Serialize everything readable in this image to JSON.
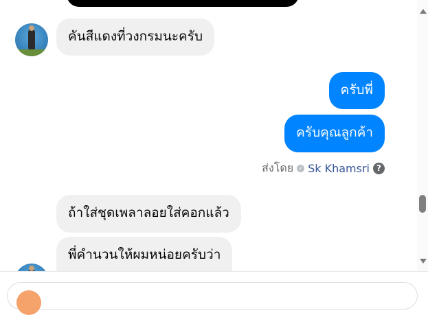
{
  "messages": [
    {
      "direction": "incoming",
      "text": "คันสีแดงที่วงกรมนะครับ"
    },
    {
      "direction": "outgoing",
      "text": "ครับพี่"
    },
    {
      "direction": "outgoing",
      "text": "ครับคุณลูกค้า"
    },
    {
      "direction": "incoming",
      "text": "ถ้าใส่ชุดเพลาลอยใส่คอกแล้ว"
    },
    {
      "direction": "incoming",
      "text": "พี่คำนวนให้ผมหน่อยครับว่า"
    }
  ],
  "sent_by": {
    "prefix": "ส่งโดย",
    "name": "Sk Khamsri",
    "help_icon": "?"
  },
  "colors": {
    "outgoing": "#0084ff",
    "incoming": "#f0f0f0",
    "seen_name": "#385898"
  }
}
